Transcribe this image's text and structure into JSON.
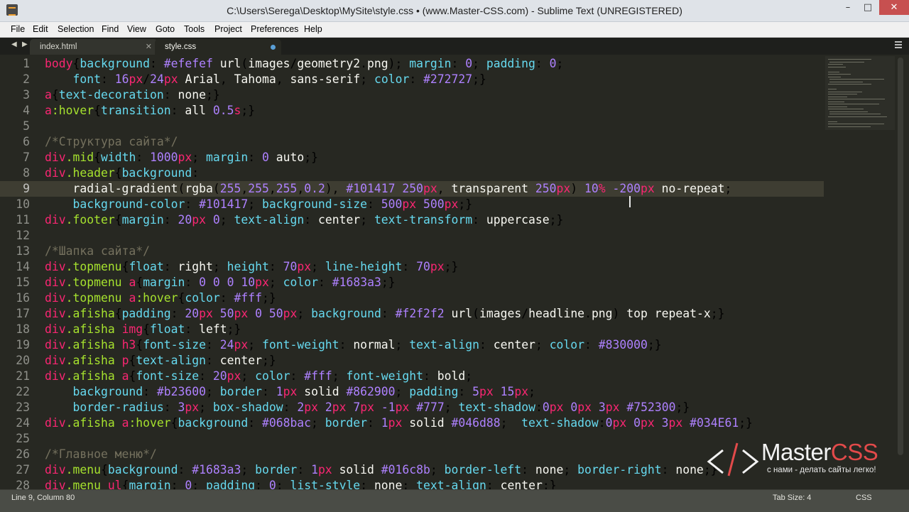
{
  "window": {
    "title": "C:\\Users\\Serega\\Desktop\\MySite\\style.css • (www.Master-CSS.com) - Sublime Text (UNREGISTERED)",
    "minimize_icon": "minimize-icon",
    "maximize_icon": "maximize-icon",
    "close_icon": "close-icon"
  },
  "menubar": {
    "items": [
      "File",
      "Edit",
      "Selection",
      "Find",
      "View",
      "Goto",
      "Tools",
      "Project",
      "Preferences",
      "Help"
    ]
  },
  "tabs": [
    {
      "label": "index.html",
      "active": false
    },
    {
      "label": "style.css",
      "active": true,
      "modified": true
    }
  ],
  "editor": {
    "current_line": 9,
    "lines": [
      {
        "n": "1",
        "code": "body{background: #efefef url(images/geometry2.png); margin: 0; padding: 0;"
      },
      {
        "n": "2",
        "code": "    font: 16px/24px Arial, Tahoma, sans-serif; color: #272727;}"
      },
      {
        "n": "3",
        "code": "a{text-decoration: none;}"
      },
      {
        "n": "4",
        "code": "a:hover{transition: all 0.5s;}"
      },
      {
        "n": "5",
        "code": ""
      },
      {
        "n": "6",
        "code": "/*Структура сайта*/"
      },
      {
        "n": "7",
        "code": "div.mid{width: 1000px; margin: 0 auto;}"
      },
      {
        "n": "8",
        "code": "div.header{background:"
      },
      {
        "n": "9",
        "code": "    radial-gradient(rgba(255,255,255,0.2), #101417 250px, transparent 250px) 10% -200px no-repeat;"
      },
      {
        "n": "10",
        "code": "    background-color: #101417; background-size: 500px 500px;}"
      },
      {
        "n": "11",
        "code": "div.footer{margin: 20px 0; text-align: center; text-transform: uppercase;}"
      },
      {
        "n": "12",
        "code": ""
      },
      {
        "n": "13",
        "code": "/*Шапка сайта*/"
      },
      {
        "n": "14",
        "code": "div.topmenu{float: right; height: 70px; line-height: 70px;}"
      },
      {
        "n": "15",
        "code": "div.topmenu a{margin: 0 0 0 10px; color: #1683a3;}"
      },
      {
        "n": "16",
        "code": "div.topmenu a:hover{color: #fff;}"
      },
      {
        "n": "17",
        "code": "div.afisha{padding: 20px 50px 0 50px; background: #f2f2f2 url(images/headline.png) top repeat-x;}"
      },
      {
        "n": "18",
        "code": "div.afisha img{float: left;}"
      },
      {
        "n": "19",
        "code": "div.afisha h3{font-size: 24px; font-weight: normal; text-align: center; color: #830000;}"
      },
      {
        "n": "20",
        "code": "div.afisha p{text-align: center;}"
      },
      {
        "n": "21",
        "code": "div.afisha a{font-size: 20px; color: #fff; font-weight: bold;"
      },
      {
        "n": "22",
        "code": "    background: #b23600; border: 1px solid #862900; padding: 5px 15px;"
      },
      {
        "n": "23",
        "code": "    border-radius: 3px; box-shadow: 2px 2px 7px -1px #777; text-shadow:0px 0px 3px #752300;}"
      },
      {
        "n": "24",
        "code": "div.afisha a:hover{background: #068bac; border: 1px solid #046d88;  text-shadow:0px 0px 3px #034E61;}"
      },
      {
        "n": "25",
        "code": ""
      },
      {
        "n": "26",
        "code": "/*Главное меню*/"
      },
      {
        "n": "27",
        "code": "div.menu{background: #1683a3; border: 1px solid #016c8b; border-left: none; border-right: none;}"
      },
      {
        "n": "28",
        "code": "div.menu ul{margin: 0; padding: 0; list-style: none; text-align: center;}"
      }
    ]
  },
  "statusbar": {
    "position": "Line 9, Column 80",
    "tab_size": "Tab Size: 4",
    "syntax": "CSS"
  },
  "watermark": {
    "name_main": "Master",
    "name_accent": "CSS",
    "tagline": "с нами - делать сайты легко!"
  },
  "colors": {
    "editor_bg": "#272822",
    "current_line_bg": "#3e3d32",
    "selector": "#a6e22e",
    "tag": "#f92672",
    "property": "#66d9ef",
    "number": "#ae81ff",
    "string": "#e6db74",
    "comment": "#75715e",
    "watermark_accent": "#e24a4a"
  }
}
